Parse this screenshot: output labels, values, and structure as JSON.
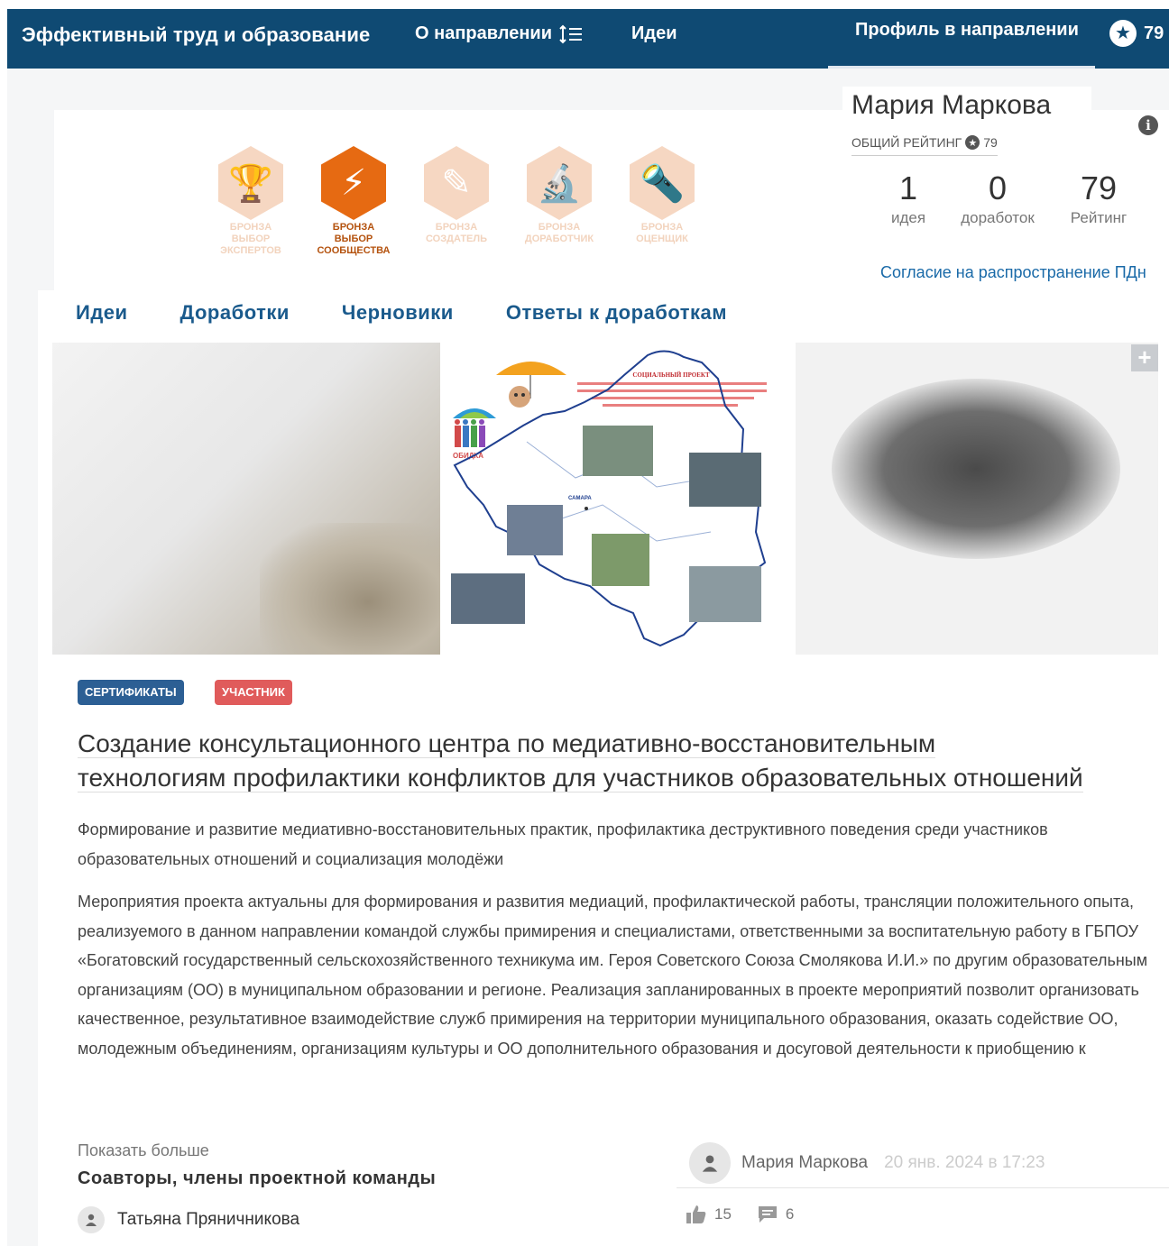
{
  "nav": {
    "brand": "Эффективный труд и образование",
    "about": "О направлении",
    "ideas": "Идеи",
    "profile": "Профиль в направлении",
    "rating": "79"
  },
  "profile": {
    "name": "Мария Маркова",
    "general_rating_label": "ОБЩИЙ РЕЙТИНГ",
    "general_rating_value": "79",
    "stats": [
      {
        "value": "1",
        "label": "идея"
      },
      {
        "value": "0",
        "label": "доработок"
      },
      {
        "value": "79",
        "label": "Рейтинг"
      }
    ],
    "consent_link": "Согласие на распространение ПДн"
  },
  "badges": [
    {
      "line1": "БРОНЗА",
      "line2": "ВЫБОР",
      "line3": "ЭКСПЕРТОВ",
      "icon": "trophy-icon",
      "active": false
    },
    {
      "line1": "БРОНЗА",
      "line2": "ВЫБОР",
      "line3": "СООБЩЕСТВА",
      "icon": "lightning-icon",
      "active": true
    },
    {
      "line1": "БРОНЗА",
      "line2": "СОЗДАТЕЛЬ",
      "line3": "",
      "icon": "pencil-icon",
      "active": false
    },
    {
      "line1": "БРОНЗА",
      "line2": "ДОРАБОТЧИК",
      "line3": "",
      "icon": "microscope-icon",
      "active": false
    },
    {
      "line1": "БРОНЗА",
      "line2": "ОЦЕНЩИК",
      "line3": "",
      "icon": "flashlight-icon",
      "active": false
    }
  ],
  "tabs": [
    "Идеи",
    "Доработки",
    "Черновики",
    "Ответы к доработкам"
  ],
  "poster": {
    "header": "СОЦИАЛЬНЫЙ ПРОЕКТ",
    "body_text": "«Создание консультационного центра по медиативно-восстановительным технологиям профилактики конфликтов для участников образовательных отношений»",
    "city": "САМАРА",
    "left_label": "ОБИДКА"
  },
  "tags": {
    "cert": "СЕРТИФИКАТЫ",
    "participant": "УЧАСТНИК"
  },
  "idea": {
    "title_line1": "Создание консультационного центра по медиативно-восстановительным",
    "title_line2": "технологиям профилактики конфликтов для участников образовательных отношений",
    "subtitle": "Формирование и развитие медиативно-восстановительных практик, профилактика деструктивного поведения среди участников образовательных отношений и социализация молодёжи",
    "description": "Мероприятия проекта актуальны для формирования и развития медиаций, профилактической работы, трансляции положительного опыта, реализуемого в данном направлении командой службы примирения и специалистами, ответственными за воспитательную работу в ГБПОУ «Богатовский государственный сельскохозяйственного техникума им. Героя Советского Союза Смолякова И.И.» по другим образовательным организациям (ОО) в муниципальном образовании и регионе. Реализация запланированных в проекте мероприятий позволит организовать качественное, результативное взаимодействие служб примирения на территории муниципального образования, оказать содействие ОО, молодежным объединениям, организациям культуры и ОО дополнительного образования и досуговой деятельности к приобщению к",
    "show_more": "Показать больше",
    "coauthors_heading": "Соавторы, члены проектной команды",
    "coauthor": "Татьяна Пряничникова",
    "author": "Мария Маркова",
    "date": "20 янв. 2024 в 17:23",
    "likes": "15",
    "comments": "6"
  },
  "colors": {
    "nav_bg": "#0f4a73",
    "badge_active": "#e66a12",
    "badge_inactive": "#f6d7c2",
    "link": "#1a5a8c",
    "tag_cert": "#2c5f94",
    "tag_participant": "#e05b5b"
  }
}
